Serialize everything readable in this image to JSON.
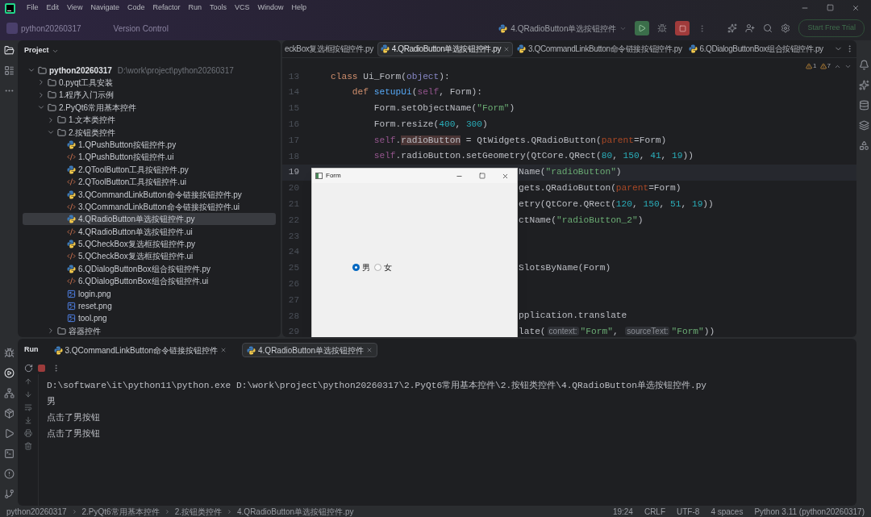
{
  "menu": [
    "File",
    "Edit",
    "View",
    "Navigate",
    "Code",
    "Refactor",
    "Run",
    "Tools",
    "VCS",
    "Window",
    "Help"
  ],
  "toolbar": {
    "project": "python20260317",
    "vcs": "Version Control",
    "run_config": "4.QRadioButton单选按钮控件",
    "trial_button": "Start Free Trial"
  },
  "project_panel": {
    "title": "Project",
    "tree": [
      {
        "name": "python20260317",
        "path": "D:\\work\\project\\python20260317",
        "kind": "folder",
        "expanded": true,
        "selected": false,
        "children": [
          {
            "name": "0.pyqt工具安装",
            "kind": "folder",
            "expanded": false,
            "selected": false
          },
          {
            "name": "1.程序入门示例",
            "kind": "folder",
            "expanded": false,
            "selected": false
          },
          {
            "name": "2.PyQt6常用基本控件",
            "kind": "folder",
            "expanded": true,
            "selected": false,
            "children": [
              {
                "name": "1.文本类控件",
                "kind": "folder",
                "expanded": false,
                "selected": false
              },
              {
                "name": "2.按钮类控件",
                "kind": "folder",
                "expanded": true,
                "selected": false,
                "children": [
                  {
                    "name": "1.QPushButton按钮控件.py",
                    "kind": "py",
                    "selected": false
                  },
                  {
                    "name": "1.QPushButton按钮控件.ui",
                    "kind": "ui",
                    "selected": false
                  },
                  {
                    "name": "2.QToolButton工具按钮控件.py",
                    "kind": "py",
                    "selected": false
                  },
                  {
                    "name": "2.QToolButton工具按钮控件.ui",
                    "kind": "ui",
                    "selected": false
                  },
                  {
                    "name": "3.QCommandLinkButton命令链接按钮控件.py",
                    "kind": "py",
                    "selected": false
                  },
                  {
                    "name": "3.QCommandLinkButton命令链接按钮控件.ui",
                    "kind": "ui",
                    "selected": false
                  },
                  {
                    "name": "4.QRadioButton单选按钮控件.py",
                    "kind": "py",
                    "selected": true
                  },
                  {
                    "name": "4.QRadioButton单选按钮控件.ui",
                    "kind": "ui",
                    "selected": false
                  },
                  {
                    "name": "5.QCheckBox复选框按钮控件.py",
                    "kind": "py",
                    "selected": false
                  },
                  {
                    "name": "5.QCheckBox复选框按钮控件.ui",
                    "kind": "ui",
                    "selected": false
                  },
                  {
                    "name": "6.QDialogButtonBox组合按钮控件.py",
                    "kind": "py",
                    "selected": false
                  },
                  {
                    "name": "6.QDialogButtonBox组合按钮控件.ui",
                    "kind": "ui",
                    "selected": false
                  },
                  {
                    "name": "login.png",
                    "kind": "png",
                    "selected": false
                  },
                  {
                    "name": "reset.png",
                    "kind": "png",
                    "selected": false
                  },
                  {
                    "name": "tool.png",
                    "kind": "png",
                    "selected": false
                  }
                ]
              },
              {
                "name": "容器控件",
                "kind": "folder",
                "expanded": false,
                "selected": false
              }
            ]
          }
        ]
      }
    ]
  },
  "editor": {
    "tabs": [
      {
        "label": "eckBox复选框按钮控件.py",
        "icon": false,
        "selected": false
      },
      {
        "label": "4.QRadioButton单选按钮控件.py",
        "icon": true,
        "selected": true
      },
      {
        "label": "3.QCommandLinkButton命令链接按钮控件.py",
        "icon": true,
        "selected": false
      },
      {
        "label": "6.QDialogButtonBox组合按钮控件.py",
        "icon": true,
        "selected": false
      }
    ],
    "warnings": [
      "1",
      "7"
    ],
    "lines": [
      {
        "number": "13",
        "covered": false,
        "current": false,
        "tokens": [
          {
            "kind": "kw",
            "text": "class "
          },
          {
            "kind": "plain",
            "text": "Ui_Form("
          },
          {
            "kind": "builtin",
            "text": "object"
          },
          {
            "kind": "plain",
            "text": "):"
          }
        ]
      },
      {
        "number": "14",
        "covered": false,
        "current": false,
        "tokens": [
          {
            "kind": "kw",
            "text": "    def "
          },
          {
            "kind": "fn",
            "text": "setupUi"
          },
          {
            "kind": "plain",
            "text": "("
          },
          {
            "kind": "self",
            "text": "self"
          },
          {
            "kind": "plain",
            "text": ", Form):"
          }
        ]
      },
      {
        "number": "15",
        "covered": false,
        "current": false,
        "tokens": [
          {
            "kind": "plain",
            "text": "        Form.setObjectName("
          },
          {
            "kind": "str",
            "text": "\"Form\""
          },
          {
            "kind": "plain",
            "text": ")"
          }
        ]
      },
      {
        "number": "16",
        "covered": false,
        "current": false,
        "tokens": [
          {
            "kind": "plain",
            "text": "        Form.resize("
          },
          {
            "kind": "num",
            "text": "400"
          },
          {
            "kind": "plain",
            "text": ", "
          },
          {
            "kind": "num",
            "text": "300"
          },
          {
            "kind": "plain",
            "text": ")"
          }
        ]
      },
      {
        "number": "17",
        "covered": false,
        "current": false,
        "tokens": [
          {
            "kind": "self",
            "text": "        self"
          },
          {
            "kind": "plain",
            "text": "."
          },
          {
            "kind": "mark",
            "text": "radioButton"
          },
          {
            "kind": "plain",
            "text": " = QtWidgets.QRadioButton("
          },
          {
            "kind": "param",
            "text": "parent"
          },
          {
            "kind": "plain",
            "text": "=Form)"
          }
        ]
      },
      {
        "number": "18",
        "covered": false,
        "current": false,
        "tokens": [
          {
            "kind": "self",
            "text": "        self"
          },
          {
            "kind": "plain",
            "text": ".radioButton.setGeometry(QtCore.QRect("
          },
          {
            "kind": "num",
            "text": "80"
          },
          {
            "kind": "plain",
            "text": ", "
          },
          {
            "kind": "num",
            "text": "150"
          },
          {
            "kind": "plain",
            "text": ", "
          },
          {
            "kind": "num",
            "text": "41"
          },
          {
            "kind": "plain",
            "text": ", "
          },
          {
            "kind": "num",
            "text": "19"
          },
          {
            "kind": "plain",
            "text": "))"
          }
        ]
      },
      {
        "number": "19",
        "covered": true,
        "current": true,
        "tokens": [
          {
            "kind": "plain",
            "text": "Name("
          },
          {
            "kind": "str",
            "text": "\"radioButton\""
          },
          {
            "kind": "plain",
            "text": ")"
          }
        ]
      },
      {
        "number": "20",
        "covered": true,
        "current": false,
        "tokens": [
          {
            "kind": "plain",
            "text": "gets.QRadioButton("
          },
          {
            "kind": "param",
            "text": "parent"
          },
          {
            "kind": "plain",
            "text": "=Form)"
          }
        ]
      },
      {
        "number": "21",
        "covered": true,
        "current": false,
        "tokens": [
          {
            "kind": "plain",
            "text": "etry(QtCore.QRect("
          },
          {
            "kind": "num",
            "text": "120"
          },
          {
            "kind": "plain",
            "text": ", "
          },
          {
            "kind": "num",
            "text": "150"
          },
          {
            "kind": "plain",
            "text": ", "
          },
          {
            "kind": "num",
            "text": "51"
          },
          {
            "kind": "plain",
            "text": ", "
          },
          {
            "kind": "num",
            "text": "19"
          },
          {
            "kind": "plain",
            "text": "))"
          }
        ]
      },
      {
        "number": "22",
        "covered": true,
        "current": false,
        "tokens": [
          {
            "kind": "plain",
            "text": "ctName("
          },
          {
            "kind": "str",
            "text": "\"radioButton_2\""
          },
          {
            "kind": "plain",
            "text": ")"
          }
        ]
      },
      {
        "number": "23",
        "current": false
      },
      {
        "number": "24",
        "current": false
      },
      {
        "number": "25",
        "covered": true,
        "current": false,
        "tokens": [
          {
            "kind": "plain",
            "text": "SlotsByName(Form)"
          }
        ]
      },
      {
        "number": "26",
        "current": false
      },
      {
        "number": "27",
        "current": false
      },
      {
        "number": "28",
        "covered": true,
        "current": false,
        "tokens": [
          {
            "kind": "plain",
            "text": "pplication.translate"
          }
        ]
      },
      {
        "number": "29",
        "covered": true,
        "current": false,
        "tokens": [
          {
            "kind": "plain",
            "text": "late("
          },
          {
            "kind": "hint",
            "text": "context:"
          },
          {
            "kind": "str",
            "text": "\"Form\""
          },
          {
            "kind": "plain",
            "text": ", "
          },
          {
            "kind": "hint",
            "text": "sourceText:"
          },
          {
            "kind": "str",
            "text": "\"Form\""
          },
          {
            "kind": "plain",
            "text": "))"
          }
        ]
      }
    ]
  },
  "form_window": {
    "title": "Form",
    "radios": [
      {
        "label": "男",
        "selected": true
      },
      {
        "label": "女",
        "selected": false
      }
    ]
  },
  "run_panel": {
    "title": "Run",
    "tabs": [
      {
        "label": "3.QCommandLinkButton命令链接按钮控件",
        "selected": false
      },
      {
        "label": "4.QRadioButton单选按钮控件",
        "selected": true
      }
    ],
    "output": [
      "D:\\software\\it\\python11\\python.exe D:\\work\\project\\python20260317\\2.PyQt6常用基本控件\\2.按钮类控件\\4.QRadioButton单选按钮控件.py",
      "男",
      "点击了男按钮",
      "点击了男按钮"
    ]
  },
  "status_bar": {
    "breadcrumbs": [
      "python20260317",
      "2.PyQt6常用基本控件",
      "2.按钮类控件",
      "4.QRadioButton单选按钮控件.py"
    ],
    "items": [
      "19:24",
      "CRLF",
      "UTF-8",
      "4 spaces",
      "Python 3.11 (python20260317)"
    ]
  }
}
